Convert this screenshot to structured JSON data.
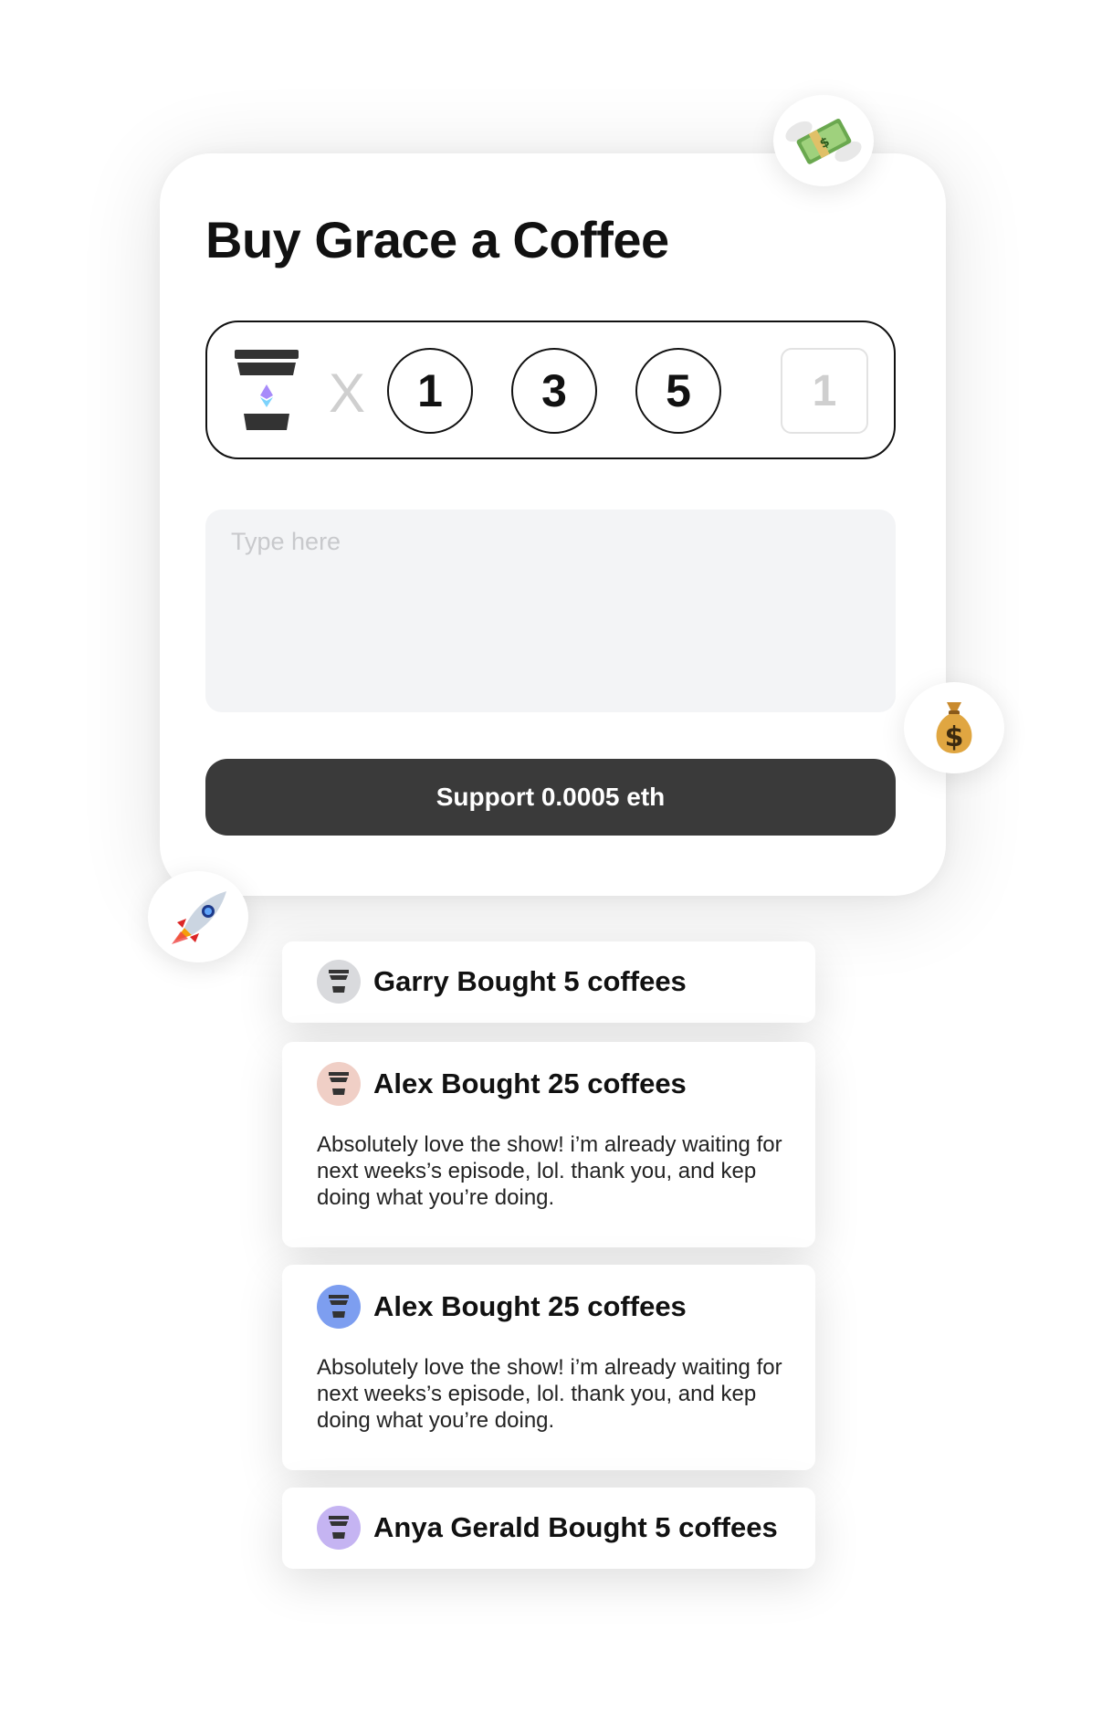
{
  "card": {
    "title": "Buy Grace a Coffee",
    "multiply_symbol": "X",
    "quantity_options": [
      "1",
      "3",
      "5"
    ],
    "custom_quantity_placeholder": "1",
    "message_placeholder": "Type here",
    "support_button_label": "Support 0.0005 eth"
  },
  "decorations": {
    "bubbles": [
      "money-with-wings",
      "money-bag",
      "rocket"
    ]
  },
  "feed": [
    {
      "title": "Garry Bought 5 coffees",
      "avatar_color": "#d9dadd",
      "message": ""
    },
    {
      "title": "Alex Bought 25 coffees",
      "avatar_color": "#f0cfc6",
      "message": "Absolutely love the show! i’m already waiting for next weeks’s episode, lol. thank you, and kep doing what you’re doing."
    },
    {
      "title": "Alex Bought 25 coffees",
      "avatar_color": "#7d9ef0",
      "message": "Absolutely love the show! i’m already waiting for next weeks’s episode, lol. thank you, and kep doing what you’re doing."
    },
    {
      "title": "Anya Gerald Bought 5 coffees",
      "avatar_color": "#c5b4f2",
      "message": ""
    }
  ],
  "colors": {
    "button_bg": "#3a3a3a",
    "input_bg": "#f3f4f6",
    "text": "#111111"
  }
}
